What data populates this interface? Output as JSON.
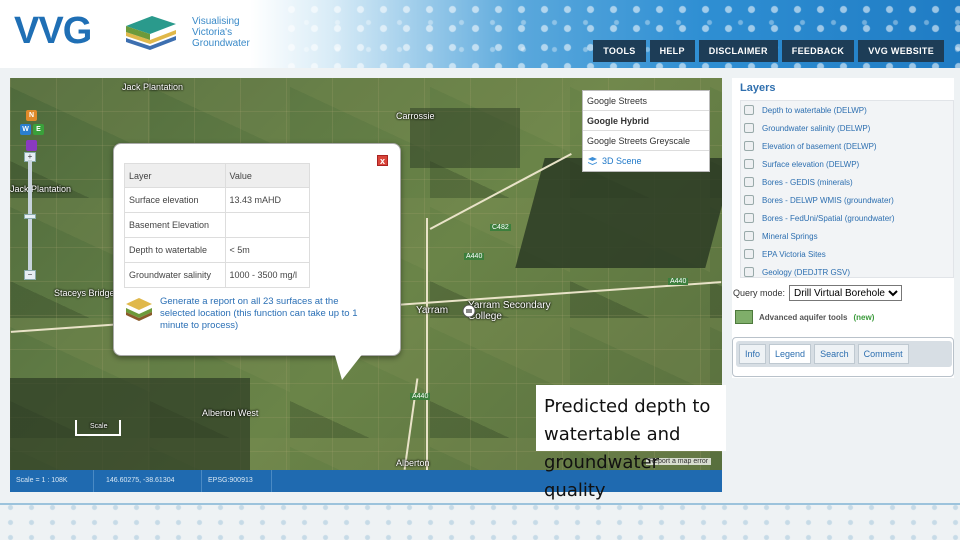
{
  "header": {
    "logo_text": "VVG",
    "logo_subtitle": [
      "Visualising",
      "Victoria's",
      "Groundwater"
    ],
    "nav": [
      "TOOLS",
      "HELP",
      "DISCLAIMER",
      "FEEDBACK",
      "VVG WEBSITE"
    ]
  },
  "map": {
    "place_labels": [
      "Jack Plantation",
      "Carrossie",
      "Jack Plantation",
      "Staceys Bridge",
      "Yarram",
      "Yarram Secondary College",
      "Alberton West",
      "Alberton"
    ],
    "road_tags": [
      "C482",
      "A440",
      "A440",
      "A440"
    ],
    "tool_badges": [
      "N",
      "W",
      "E"
    ],
    "basemaps": [
      "Google Streets",
      "Google Hybrid",
      "Google Streets Greyscale",
      "3D Scene"
    ],
    "report_error": "Report a map error",
    "scale_label": "Scale"
  },
  "popup": {
    "columns": [
      "Layer",
      "Value"
    ],
    "rows": [
      [
        "Surface elevation",
        "13.43 mAHD"
      ],
      [
        "Basement Elevation",
        ""
      ],
      [
        "Depth to watertable",
        "< 5m"
      ],
      [
        "Groundwater salinity",
        "1000 - 3500 mg/l"
      ]
    ],
    "close": "x",
    "report_text": "Generate a report on all 23 surfaces at the selected location (this function can take up to 1 minute to process)"
  },
  "status": {
    "scale": "Scale = 1 : 108K",
    "coords": "146.60275, -38.61304",
    "epsg": "EPSG:900913"
  },
  "caption": "Predicted depth to watertable and groundwater quality",
  "layers": {
    "title": "Layers",
    "items": [
      "Depth to watertable (DELWP)",
      "Groundwater salinity (DELWP)",
      "Elevation of basement (DELWP)",
      "Surface elevation (DELWP)",
      "Bores - GEDIS (minerals)",
      "Bores - DELWP WMIS (groundwater)",
      "Bores - FedUni/Spatial (groundwater)",
      "Mineral Springs",
      "EPA Victoria Sites",
      "Geology (DEDJTR GSV)"
    ],
    "query_label": "Query mode:",
    "query_value": "Drill Virtual Borehole",
    "advanced_label": "Advanced aquifer tools",
    "advanced_new": "(new)",
    "tabs": [
      "Info",
      "Legend",
      "Search",
      "Comment"
    ],
    "active_tab": "Legend"
  },
  "colors": {
    "brand_blue": "#1f6fb5",
    "nav_bg": "#1d3d57",
    "status_bar": "#1f6ab0",
    "link_blue": "#2d6fb0",
    "close_red": "#d9453a"
  }
}
